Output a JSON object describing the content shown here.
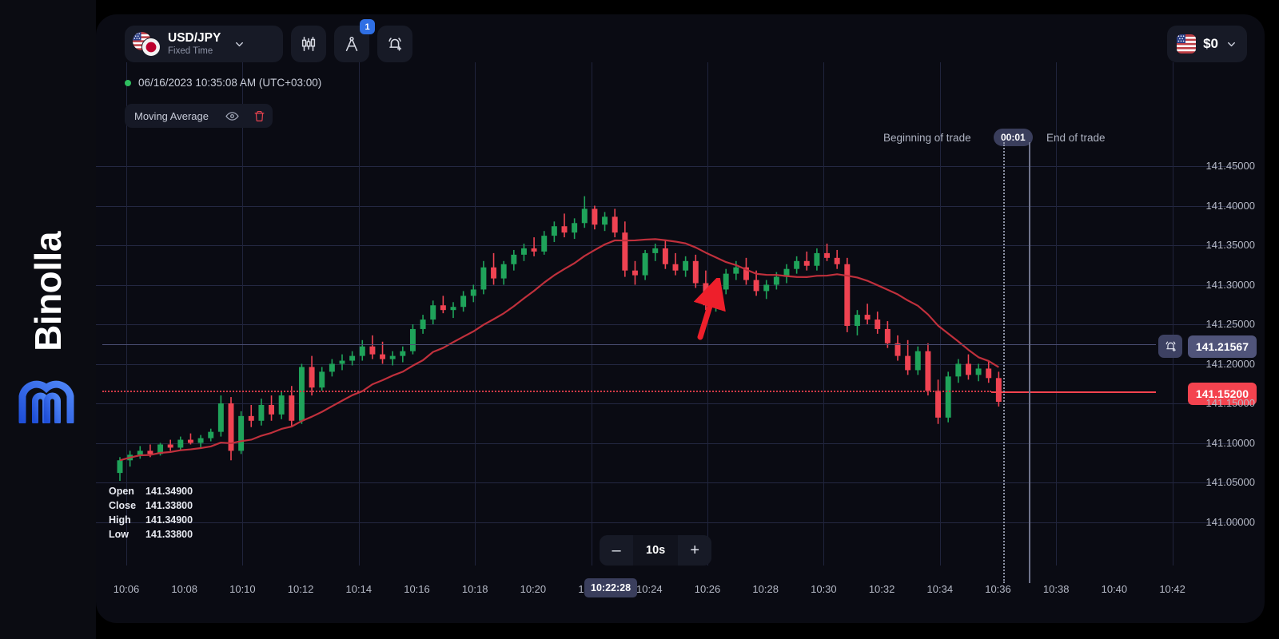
{
  "brand": {
    "name": "Binolla",
    "mark_icon": "binolla-m-logo"
  },
  "toolbar": {
    "instrument": {
      "name": "USD/JPY",
      "mode": "Fixed Time",
      "flag_left": "us-flag-icon",
      "flag_right": "jp-flag-icon",
      "chevron": "chevron-down-icon"
    },
    "chart_type_icon": "candlestick-icon",
    "drawing_icon": "compass-draw-icon",
    "drawing_badge": "1",
    "alert_icon": "bell-add-icon"
  },
  "balance": {
    "flag": "us-flag-icon",
    "amount": "$0",
    "chevron": "chevron-down-icon"
  },
  "status": {
    "timestamp": "06/16/2023 10:35:08 AM  (UTC+03:00)"
  },
  "indicator": {
    "name": "Moving Average",
    "eye_icon": "eye-icon",
    "delete_icon": "trash-icon"
  },
  "trade": {
    "begin_label": "Beginning of trade",
    "end_label": "End of trade",
    "timer": "00:01"
  },
  "price_tags": {
    "alert_price": "141.21567",
    "alert_icon": "bell-add-icon",
    "current_price": "141.15200"
  },
  "ohlc": {
    "rows": [
      {
        "key": "Open",
        "value": "141.34900"
      },
      {
        "key": "Close",
        "value": "141.33800"
      },
      {
        "key": "High",
        "value": "141.34900"
      },
      {
        "key": "Low",
        "value": "141.33800"
      }
    ]
  },
  "timeframe": {
    "minus": "–",
    "value": "10s",
    "plus": "+"
  },
  "time_cursor": "10:22:28",
  "colors": {
    "bg": "#0a0b13",
    "grid": "#242842",
    "bull": "#1fa35a",
    "bear": "#ef4352",
    "ma_line": "#c0303c",
    "accent_blue": "#2f6fe4",
    "alert_purple": "#50547a",
    "price_red": "#f4434f"
  },
  "chart_data": {
    "type": "candlestick",
    "title": "USD/JPY Fixed Time",
    "xlabel": "",
    "ylabel": "",
    "ylim": [
      141.0,
      141.45
    ],
    "y_ticks": [
      "141.45000",
      "141.40000",
      "141.35000",
      "141.30000",
      "141.25000",
      "141.20000",
      "141.15000",
      "141.10000",
      "141.05000",
      "141.00000"
    ],
    "x_ticks": [
      "10:06",
      "10:08",
      "10:10",
      "10:12",
      "10:14",
      "10:16",
      "10:18",
      "10:20",
      "10:22",
      "10:24",
      "10:26",
      "10:28",
      "10:30",
      "10:32",
      "10:34",
      "10:36",
      "10:38",
      "10:40",
      "10:42"
    ],
    "grid": true,
    "legend": "none",
    "interval": "10s",
    "annotations": [
      {
        "type": "arrow",
        "color": "#ee1f2b",
        "x": 880,
        "y": 350,
        "note": "upward pointer on chart"
      },
      {
        "type": "hline-dotted",
        "value": 141.152,
        "color": "#d03a46"
      },
      {
        "type": "hline",
        "value": 141.21567,
        "color": "#4a4e72"
      },
      {
        "type": "vline-dotted",
        "label": "Beginning of trade"
      },
      {
        "type": "vline",
        "label": "End of trade"
      }
    ],
    "overlays": [
      {
        "name": "Moving Average",
        "color": "#c0303c",
        "type": "line"
      }
    ],
    "candles": [
      {
        "t": "10:06:00",
        "o": 141.062,
        "h": 141.082,
        "l": 141.052,
        "c": 141.078
      },
      {
        "t": "10:06:20",
        "o": 141.078,
        "h": 141.09,
        "l": 141.07,
        "c": 141.085
      },
      {
        "t": "10:06:40",
        "o": 141.085,
        "h": 141.096,
        "l": 141.08,
        "c": 141.09
      },
      {
        "t": "10:07:00",
        "o": 141.09,
        "h": 141.098,
        "l": 141.082,
        "c": 141.086
      },
      {
        "t": "10:07:20",
        "o": 141.086,
        "h": 141.1,
        "l": 141.084,
        "c": 141.098
      },
      {
        "t": "10:07:40",
        "o": 141.098,
        "h": 141.104,
        "l": 141.09,
        "c": 141.094
      },
      {
        "t": "10:08:00",
        "o": 141.094,
        "h": 141.108,
        "l": 141.09,
        "c": 141.104
      },
      {
        "t": "10:08:20",
        "o": 141.104,
        "h": 141.112,
        "l": 141.098,
        "c": 141.1
      },
      {
        "t": "10:08:40",
        "o": 141.1,
        "h": 141.11,
        "l": 141.094,
        "c": 141.106
      },
      {
        "t": "10:09:00",
        "o": 141.106,
        "h": 141.118,
        "l": 141.102,
        "c": 141.114
      },
      {
        "t": "10:09:20",
        "o": 141.114,
        "h": 141.16,
        "l": 141.108,
        "c": 141.15
      },
      {
        "t": "10:09:40",
        "o": 141.15,
        "h": 141.158,
        "l": 141.078,
        "c": 141.09
      },
      {
        "t": "10:10:00",
        "o": 141.09,
        "h": 141.14,
        "l": 141.086,
        "c": 141.134
      },
      {
        "t": "10:10:20",
        "o": 141.134,
        "h": 141.148,
        "l": 141.12,
        "c": 141.128
      },
      {
        "t": "10:10:40",
        "o": 141.128,
        "h": 141.156,
        "l": 141.122,
        "c": 141.148
      },
      {
        "t": "10:11:00",
        "o": 141.148,
        "h": 141.16,
        "l": 141.128,
        "c": 141.136
      },
      {
        "t": "10:11:20",
        "o": 141.136,
        "h": 141.166,
        "l": 141.13,
        "c": 141.16
      },
      {
        "t": "10:11:40",
        "o": 141.16,
        "h": 141.172,
        "l": 141.12,
        "c": 141.128
      },
      {
        "t": "10:12:00",
        "o": 141.128,
        "h": 141.2,
        "l": 141.124,
        "c": 141.196
      },
      {
        "t": "10:12:20",
        "o": 141.196,
        "h": 141.21,
        "l": 141.16,
        "c": 141.17
      },
      {
        "t": "10:12:40",
        "o": 141.17,
        "h": 141.196,
        "l": 141.166,
        "c": 141.19
      },
      {
        "t": "10:13:00",
        "o": 141.19,
        "h": 141.206,
        "l": 141.184,
        "c": 141.2
      },
      {
        "t": "10:13:20",
        "o": 141.2,
        "h": 141.212,
        "l": 141.192,
        "c": 141.204
      },
      {
        "t": "10:13:40",
        "o": 141.204,
        "h": 141.216,
        "l": 141.198,
        "c": 141.21
      },
      {
        "t": "10:14:00",
        "o": 141.21,
        "h": 141.23,
        "l": 141.204,
        "c": 141.222
      },
      {
        "t": "10:14:20",
        "o": 141.222,
        "h": 141.236,
        "l": 141.206,
        "c": 141.212
      },
      {
        "t": "10:14:40",
        "o": 141.212,
        "h": 141.228,
        "l": 141.2,
        "c": 141.206
      },
      {
        "t": "10:15:00",
        "o": 141.206,
        "h": 141.216,
        "l": 141.198,
        "c": 141.21
      },
      {
        "t": "10:15:20",
        "o": 141.21,
        "h": 141.222,
        "l": 141.202,
        "c": 141.216
      },
      {
        "t": "10:15:40",
        "o": 141.216,
        "h": 141.25,
        "l": 141.212,
        "c": 141.244
      },
      {
        "t": "10:16:00",
        "o": 141.244,
        "h": 141.262,
        "l": 141.238,
        "c": 141.256
      },
      {
        "t": "10:16:20",
        "o": 141.256,
        "h": 141.28,
        "l": 141.25,
        "c": 141.274
      },
      {
        "t": "10:16:40",
        "o": 141.274,
        "h": 141.286,
        "l": 141.264,
        "c": 141.268
      },
      {
        "t": "10:17:00",
        "o": 141.268,
        "h": 141.278,
        "l": 141.258,
        "c": 141.272
      },
      {
        "t": "10:17:20",
        "o": 141.272,
        "h": 141.292,
        "l": 141.266,
        "c": 141.286
      },
      {
        "t": "10:17:40",
        "o": 141.286,
        "h": 141.3,
        "l": 141.278,
        "c": 141.294
      },
      {
        "t": "10:18:00",
        "o": 141.294,
        "h": 141.33,
        "l": 141.288,
        "c": 141.322
      },
      {
        "t": "10:18:20",
        "o": 141.322,
        "h": 141.34,
        "l": 141.3,
        "c": 141.308
      },
      {
        "t": "10:18:40",
        "o": 141.308,
        "h": 141.33,
        "l": 141.3,
        "c": 141.326
      },
      {
        "t": "10:19:00",
        "o": 141.326,
        "h": 141.344,
        "l": 141.318,
        "c": 141.338
      },
      {
        "t": "10:19:20",
        "o": 141.338,
        "h": 141.352,
        "l": 141.33,
        "c": 141.346
      },
      {
        "t": "10:19:40",
        "o": 141.346,
        "h": 141.36,
        "l": 141.336,
        "c": 141.342
      },
      {
        "t": "10:20:00",
        "o": 141.342,
        "h": 141.368,
        "l": 141.338,
        "c": 141.362
      },
      {
        "t": "10:20:20",
        "o": 141.362,
        "h": 141.38,
        "l": 141.354,
        "c": 141.374
      },
      {
        "t": "10:20:40",
        "o": 141.374,
        "h": 141.39,
        "l": 141.36,
        "c": 141.366
      },
      {
        "t": "10:21:00",
        "o": 141.366,
        "h": 141.384,
        "l": 141.358,
        "c": 141.378
      },
      {
        "t": "10:21:20",
        "o": 141.378,
        "h": 141.412,
        "l": 141.372,
        "c": 141.396
      },
      {
        "t": "10:21:40",
        "o": 141.396,
        "h": 141.4,
        "l": 141.37,
        "c": 141.376
      },
      {
        "t": "10:22:00",
        "o": 141.376,
        "h": 141.392,
        "l": 141.368,
        "c": 141.386
      },
      {
        "t": "10:22:20",
        "o": 141.386,
        "h": 141.396,
        "l": 141.36,
        "c": 141.366
      },
      {
        "t": "10:22:40",
        "o": 141.366,
        "h": 141.38,
        "l": 141.31,
        "c": 141.318
      },
      {
        "t": "10:23:00",
        "o": 141.318,
        "h": 141.33,
        "l": 141.3,
        "c": 141.312
      },
      {
        "t": "10:23:20",
        "o": 141.312,
        "h": 141.344,
        "l": 141.306,
        "c": 141.34
      },
      {
        "t": "10:23:40",
        "o": 141.34,
        "h": 141.352,
        "l": 141.33,
        "c": 141.346
      },
      {
        "t": "10:24:00",
        "o": 141.346,
        "h": 141.356,
        "l": 141.32,
        "c": 141.326
      },
      {
        "t": "10:24:20",
        "o": 141.326,
        "h": 141.34,
        "l": 141.312,
        "c": 141.318
      },
      {
        "t": "10:24:40",
        "o": 141.318,
        "h": 141.336,
        "l": 141.31,
        "c": 141.33
      },
      {
        "t": "10:25:00",
        "o": 141.33,
        "h": 141.338,
        "l": 141.296,
        "c": 141.302
      },
      {
        "t": "10:25:20",
        "o": 141.302,
        "h": 141.318,
        "l": 141.268,
        "c": 141.274
      },
      {
        "t": "10:25:40",
        "o": 141.274,
        "h": 141.3,
        "l": 141.266,
        "c": 141.294
      },
      {
        "t": "10:26:00",
        "o": 141.294,
        "h": 141.32,
        "l": 141.288,
        "c": 141.314
      },
      {
        "t": "10:26:20",
        "o": 141.314,
        "h": 141.33,
        "l": 141.306,
        "c": 141.322
      },
      {
        "t": "10:26:40",
        "o": 141.322,
        "h": 141.334,
        "l": 141.3,
        "c": 141.306
      },
      {
        "t": "10:27:00",
        "o": 141.306,
        "h": 141.318,
        "l": 141.286,
        "c": 141.292
      },
      {
        "t": "10:27:20",
        "o": 141.292,
        "h": 141.306,
        "l": 141.282,
        "c": 141.3
      },
      {
        "t": "10:27:40",
        "o": 141.3,
        "h": 141.316,
        "l": 141.294,
        "c": 141.31
      },
      {
        "t": "10:28:00",
        "o": 141.31,
        "h": 141.326,
        "l": 141.302,
        "c": 141.32
      },
      {
        "t": "10:28:20",
        "o": 141.32,
        "h": 141.336,
        "l": 141.314,
        "c": 141.33
      },
      {
        "t": "10:28:40",
        "o": 141.33,
        "h": 141.342,
        "l": 141.318,
        "c": 141.324
      },
      {
        "t": "10:29:00",
        "o": 141.324,
        "h": 141.346,
        "l": 141.318,
        "c": 141.34
      },
      {
        "t": "10:29:20",
        "o": 141.34,
        "h": 141.352,
        "l": 141.33,
        "c": 141.334
      },
      {
        "t": "10:29:40",
        "o": 141.334,
        "h": 141.344,
        "l": 141.32,
        "c": 141.326
      },
      {
        "t": "10:30:00",
        "o": 141.326,
        "h": 141.334,
        "l": 141.24,
        "c": 141.248
      },
      {
        "t": "10:30:20",
        "o": 141.248,
        "h": 141.268,
        "l": 141.236,
        "c": 141.262
      },
      {
        "t": "10:30:40",
        "o": 141.262,
        "h": 141.276,
        "l": 141.25,
        "c": 141.256
      },
      {
        "t": "10:31:00",
        "o": 141.256,
        "h": 141.266,
        "l": 141.238,
        "c": 141.244
      },
      {
        "t": "10:31:20",
        "o": 141.244,
        "h": 141.254,
        "l": 141.22,
        "c": 141.226
      },
      {
        "t": "10:31:40",
        "o": 141.226,
        "h": 141.236,
        "l": 141.204,
        "c": 141.21
      },
      {
        "t": "10:32:00",
        "o": 141.21,
        "h": 141.23,
        "l": 141.186,
        "c": 141.192
      },
      {
        "t": "10:32:20",
        "o": 141.192,
        "h": 141.222,
        "l": 141.186,
        "c": 141.216
      },
      {
        "t": "10:32:40",
        "o": 141.216,
        "h": 141.226,
        "l": 141.16,
        "c": 141.166
      },
      {
        "t": "10:33:00",
        "o": 141.166,
        "h": 141.18,
        "l": 141.124,
        "c": 141.132
      },
      {
        "t": "10:33:20",
        "o": 141.132,
        "h": 141.19,
        "l": 141.126,
        "c": 141.184
      },
      {
        "t": "10:33:40",
        "o": 141.184,
        "h": 141.206,
        "l": 141.176,
        "c": 141.2
      },
      {
        "t": "10:34:00",
        "o": 141.2,
        "h": 141.212,
        "l": 141.18,
        "c": 141.186
      },
      {
        "t": "10:34:20",
        "o": 141.186,
        "h": 141.2,
        "l": 141.178,
        "c": 141.194
      },
      {
        "t": "10:34:40",
        "o": 141.194,
        "h": 141.204,
        "l": 141.176,
        "c": 141.182
      },
      {
        "t": "10:35:00",
        "o": 141.182,
        "h": 141.19,
        "l": 141.146,
        "c": 141.152
      }
    ]
  }
}
